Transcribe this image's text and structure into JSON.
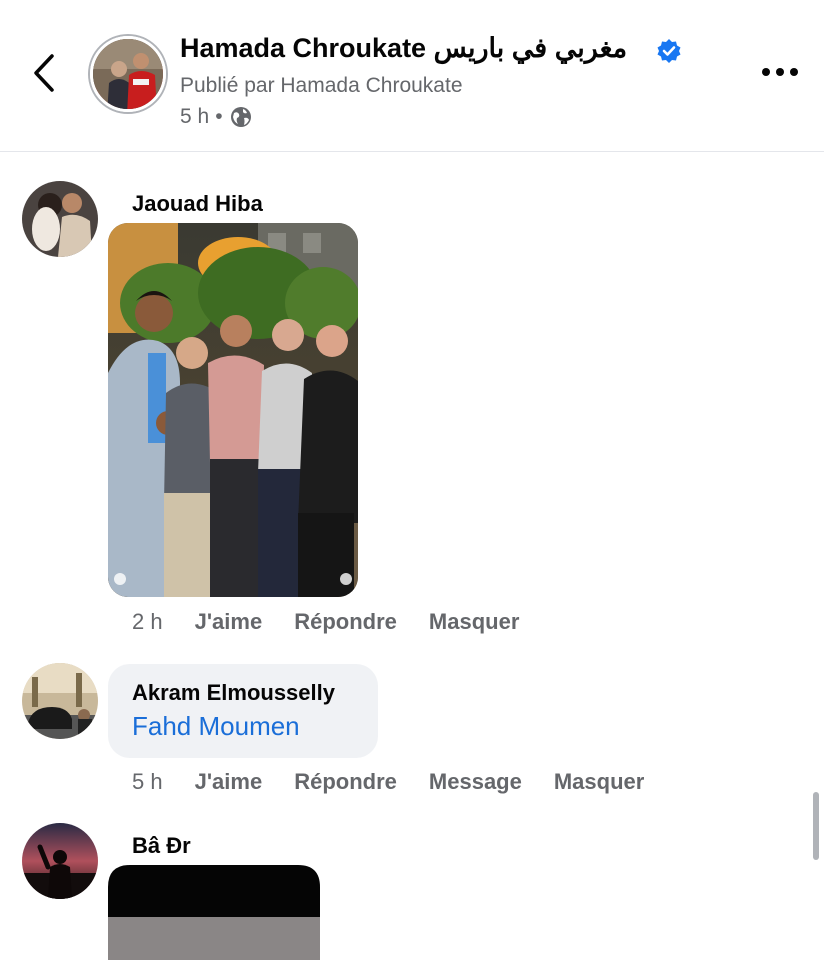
{
  "header": {
    "title": "Hamada Chroukate مغربي في باريس",
    "subtitle": "Publié par Hamada Chroukate",
    "time": "5 h",
    "separator": "•",
    "icons": [
      "back-chevron-icon",
      "verified-badge-icon",
      "globe-icon",
      "more-options-icon"
    ],
    "accent_color": "#1877f2"
  },
  "comments": [
    {
      "author": "Jaouad Hiba",
      "attachment": "photo",
      "time": "2 h",
      "actions": [
        "J'aime",
        "Répondre",
        "Masquer"
      ]
    },
    {
      "author": "Akram Elmousselly",
      "mention": "Fahd Moumen",
      "time": "5 h",
      "actions": [
        "J'aime",
        "Répondre",
        "Message",
        "Masquer"
      ]
    },
    {
      "author": "Bâ Đr",
      "attachment": "video"
    }
  ],
  "colors": {
    "link": "#1a6ed8",
    "secondary_text": "#65676b",
    "bubble": "#f0f2f5"
  }
}
